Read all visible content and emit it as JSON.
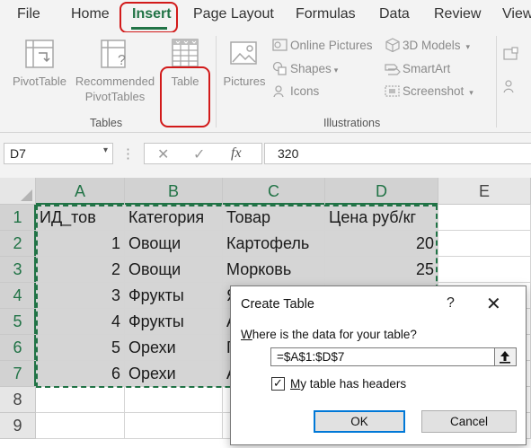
{
  "menu": {
    "tabs": [
      "File",
      "Home",
      "Insert",
      "Page Layout",
      "Formulas",
      "Data",
      "Review",
      "View"
    ],
    "active": "Insert"
  },
  "ribbon": {
    "tables": {
      "pivot_table": "PivotTable",
      "recommended_line1": "Recommended",
      "recommended_line2": "PivotTables",
      "table": "Table",
      "group_label": "Tables"
    },
    "illustrations": {
      "pictures": "Pictures",
      "online_pictures": "Online Pictures",
      "shapes": "Shapes",
      "icons": "Icons",
      "models_3d": "3D Models",
      "smartart": "SmartArt",
      "screenshot": "Screenshot",
      "group_label": "Illustrations"
    }
  },
  "formula_bar": {
    "name_box": "D7",
    "fx": "fx",
    "formula": "320"
  },
  "sheet": {
    "columns": [
      "A",
      "B",
      "C",
      "D",
      "E"
    ],
    "rows": [
      "1",
      "2",
      "3",
      "4",
      "5",
      "6",
      "7",
      "8",
      "9"
    ],
    "cells": [
      [
        "ИД_тов",
        "Категория",
        "Товар",
        "Цена руб/кг"
      ],
      [
        "1",
        "Овощи",
        "Картофель",
        "20"
      ],
      [
        "2",
        "Овощи",
        "Морковь",
        "25"
      ],
      [
        "3",
        "Фрукты",
        "Я",
        ""
      ],
      [
        "4",
        "Фрукты",
        "А",
        ""
      ],
      [
        "5",
        "Орехи",
        "Г",
        ""
      ],
      [
        "6",
        "Орехи",
        "А",
        ""
      ]
    ]
  },
  "dialog": {
    "title": "Create Table",
    "help": "?",
    "close": "✕",
    "prompt_underlined": "W",
    "prompt_rest": "here is the data for your table?",
    "range_value": "=$A$1:$D$7",
    "checkbox_checked": true,
    "checkbox_underlined": "M",
    "checkbox_rest": "y table has headers",
    "ok_label": "OK",
    "cancel_label": "Cancel"
  },
  "colors": {
    "accent": "#217346",
    "highlight": "#d21a1a",
    "selection": "#d5d5d5",
    "ribbon_bg": "#f3f3f3"
  }
}
